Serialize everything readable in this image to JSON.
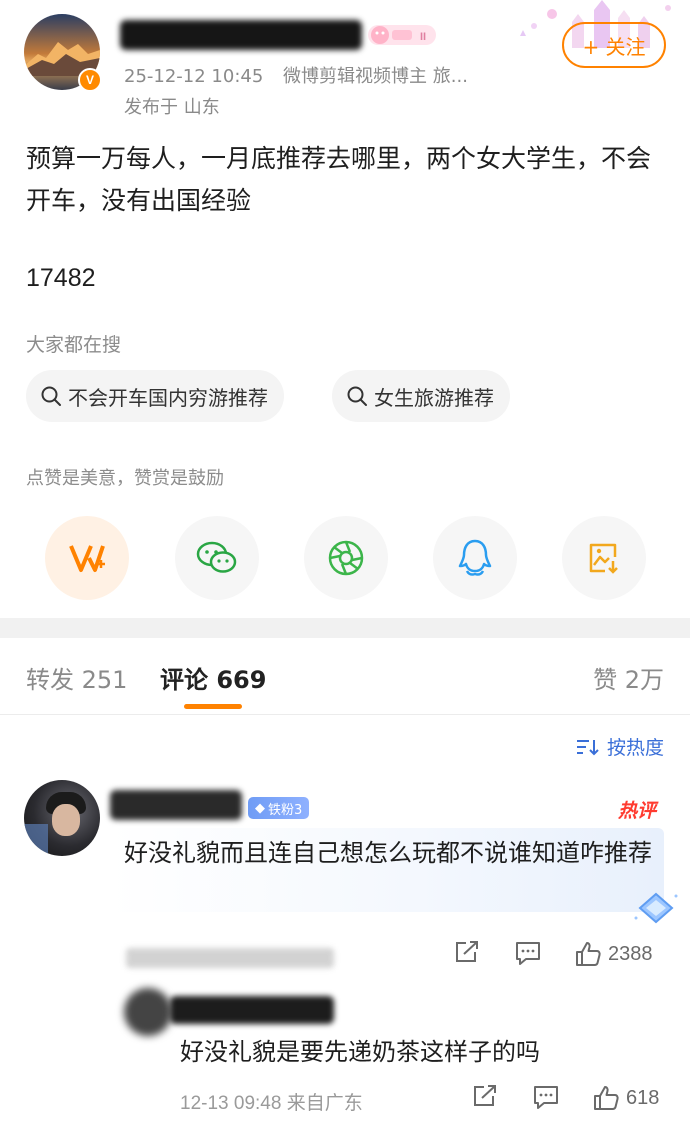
{
  "post": {
    "author_name": "",
    "timestamp": "25-12-12 10:45",
    "author_title": "微博剪辑视频博主 旅...",
    "location": "发布于 山东",
    "follow_label": "+ 关注",
    "text": "预算一万每人，一月底推荐去哪里，两个女大学生，不会开车，没有出国经验",
    "number": "17482"
  },
  "search": {
    "title": "大家都在搜",
    "chips": [
      "不会开车国内穷游推荐",
      "女生旅游推荐"
    ]
  },
  "reward": {
    "tip": "点赞是美意，赞赏是鼓励"
  },
  "share": {
    "icons": [
      "vplus-reward-icon",
      "wechat-icon",
      "moments-icon",
      "qq-icon",
      "save-image-icon"
    ]
  },
  "tabs": {
    "repost": "转发 251",
    "comment": "评论 669",
    "like": "赞 2万"
  },
  "sort": {
    "label": "按热度"
  },
  "comments": [
    {
      "fan_badge": "铁粉3",
      "hot_tag": "热评",
      "text": "好没礼貌而且连自己想怎么玩都不说谁知道咋推荐",
      "likes": "2388"
    }
  ],
  "reply": {
    "text": "好没礼貌是要先递奶茶这样子的吗",
    "meta": "12-13 09:48 来自广东",
    "likes": "618"
  },
  "colors": {
    "accent": "#ff8200",
    "link": "#3a6fd8",
    "hot": "#ff3b30"
  }
}
